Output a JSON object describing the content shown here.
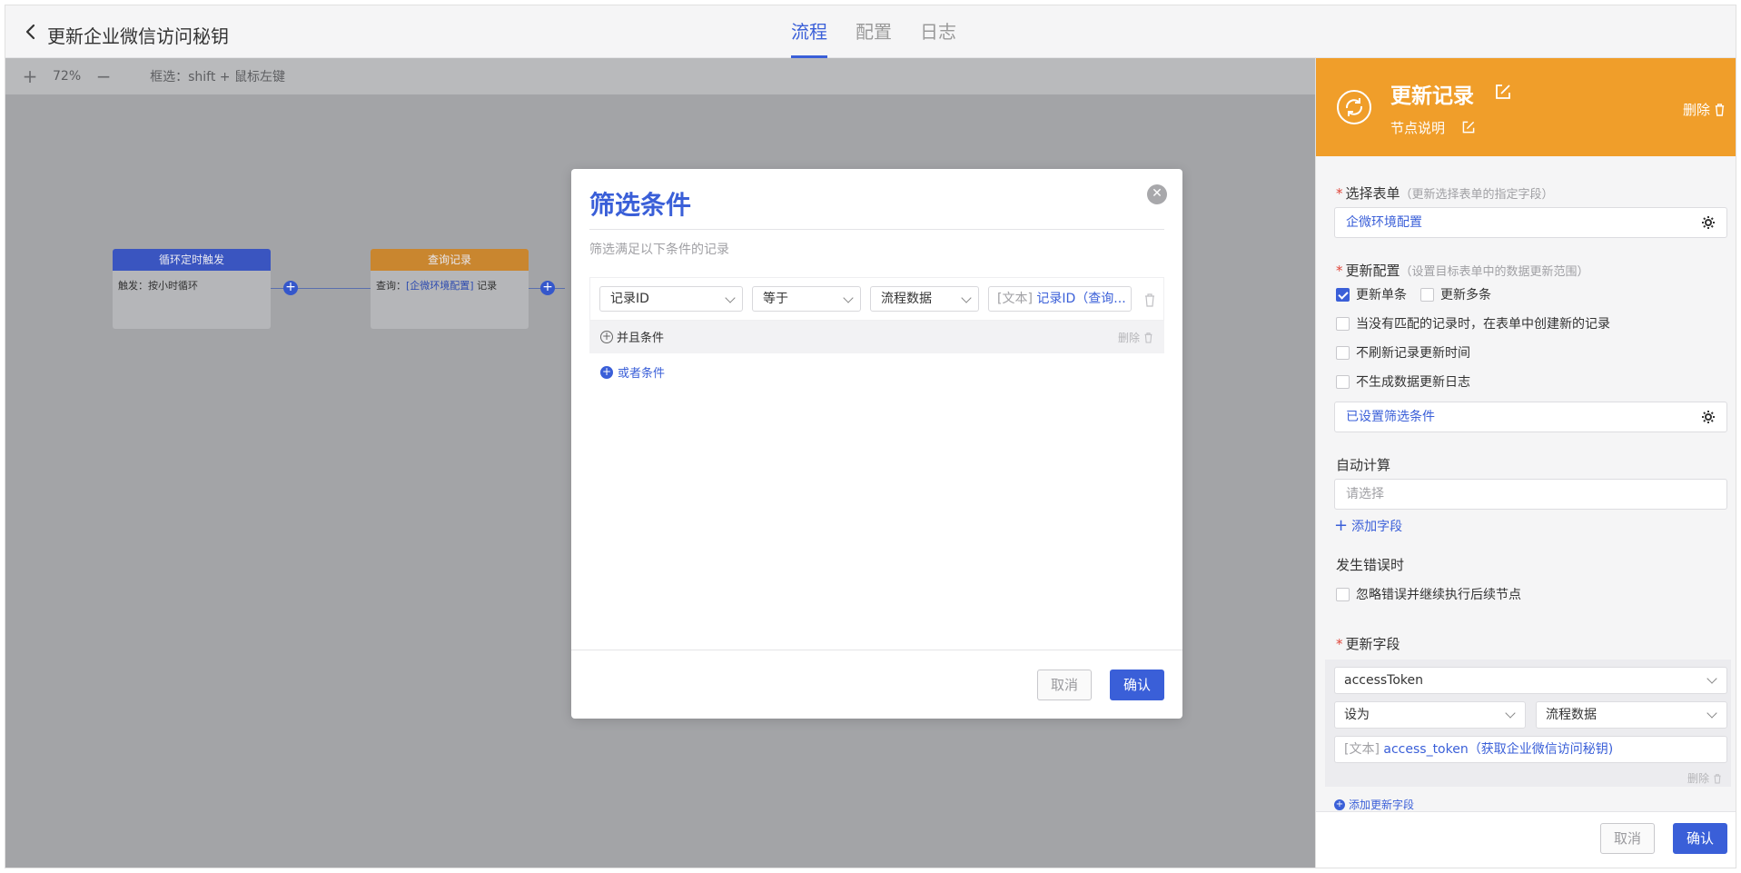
{
  "header": {
    "title": "更新企业微信访问秘钥",
    "tabs": [
      {
        "label": "流程",
        "active": true
      },
      {
        "label": "配置",
        "active": false
      },
      {
        "label": "日志",
        "active": false
      }
    ]
  },
  "canvas": {
    "zoom": "72%",
    "hint": "框选：shift + 鼠标左键",
    "nodes": [
      {
        "title": "循环定时触发",
        "body_prefix": "触发：",
        "body_value": "按小时循环",
        "color": "#2f4fc4"
      },
      {
        "title": "查询记录",
        "body_prefix": "查询：",
        "body_highlight": "[企微环境配置]",
        "body_suffix": " 记录",
        "color": "#d88a24"
      }
    ]
  },
  "dialog": {
    "title": "筛选条件",
    "subtitle": "筛选满足以下条件的记录",
    "condition": {
      "field": "记录ID",
      "operator": "等于",
      "source": "流程数据",
      "value_prefix": "[文本]",
      "value": "记录ID（查询..."
    },
    "and_label": "并且条件",
    "delete_label": "删除",
    "or_label": "或者条件",
    "cancel_label": "取消",
    "confirm_label": "确认"
  },
  "panel": {
    "title": "更新记录",
    "description": "节点说明",
    "delete_label": "删除",
    "select_form": {
      "label": "选择表单",
      "hint": "（更新选择表单的指定字段）",
      "value": "企微环境配置"
    },
    "update_config": {
      "label": "更新配置",
      "hint": "（设置目标表单中的数据更新范围）",
      "single_label": "更新单条",
      "single_checked": true,
      "multi_label": "更新多条",
      "multi_checked": false,
      "options": [
        {
          "label": "当没有匹配的记录时，在表单中创建新的记录",
          "checked": false
        },
        {
          "label": "不刷新记录更新时间",
          "checked": false
        },
        {
          "label": "不生成数据更新日志",
          "checked": false
        }
      ],
      "filter_value": "已设置筛选条件"
    },
    "auto_calc": {
      "label": "自动计算",
      "placeholder": "请选择",
      "add_field": "添加字段"
    },
    "on_error": {
      "label": "发生错误时",
      "option": "忽略错误并继续执行后续节点",
      "checked": false
    },
    "update_fields": {
      "label": "更新字段",
      "field": "accessToken",
      "op": "设为",
      "source": "流程数据",
      "value_prefix": "[文本]",
      "value": "access_token（获取企业微信访问秘钥)",
      "delete_label": "删除",
      "add_label": "添加更新字段"
    },
    "cancel_label": "取消",
    "confirm_label": "确认"
  }
}
